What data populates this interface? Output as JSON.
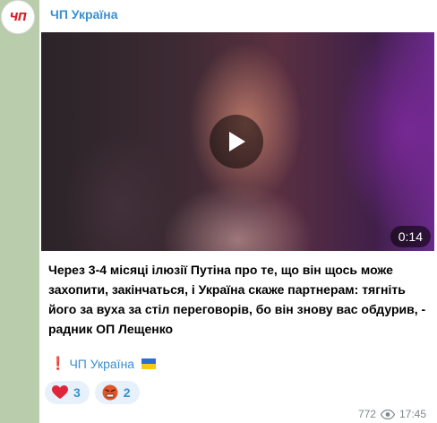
{
  "avatar": {
    "text": "ЧП"
  },
  "channel": {
    "name": "ЧП Україна"
  },
  "media": {
    "duration": "0:14",
    "play_icon": "play-icon"
  },
  "message": {
    "text": "Через 3-4 місяці ілюзії Путіна про те, що він щось може захопити, закінчаться, і Україна скаже партнерам: тягніть його за вуха за стіл переговорів, бо він знову вас обдурив, - радник ОП Лещенко"
  },
  "signature": {
    "mark": "❗",
    "label": "ЧП Україна",
    "flag_icon": "ukraine-flag-icon"
  },
  "reactions": [
    {
      "icon": "heart-icon",
      "count": "3"
    },
    {
      "icon": "angry-face-icon",
      "count": "2"
    }
  ],
  "meta": {
    "views": "772",
    "views_icon": "eye-icon",
    "time": "17:45"
  },
  "colors": {
    "accent": "#3a8fd0",
    "background": "#b9ccac",
    "bubble": "#ffffff",
    "reaction_bg": "#e6f1fb"
  }
}
